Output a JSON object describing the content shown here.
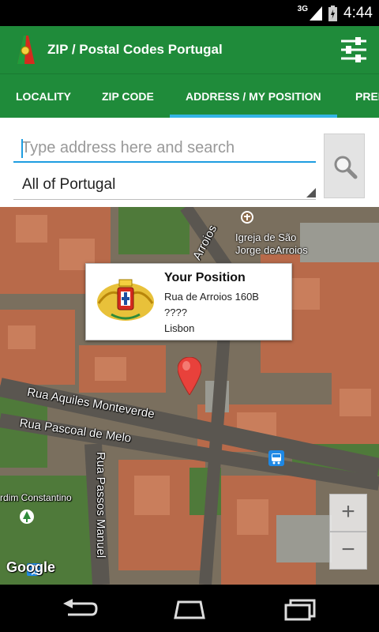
{
  "status_bar": {
    "network": "3G",
    "time": "4:44"
  },
  "app": {
    "title": "ZIP / Postal Codes Portugal",
    "icon": "portugal-flag-icon",
    "menu_icon": "sliders-icon"
  },
  "tabs": [
    {
      "label": "LOCALITY",
      "active": false
    },
    {
      "label": "ZIP CODE",
      "active": false
    },
    {
      "label": "ADDRESS / MY POSITION",
      "active": true
    },
    {
      "label": "PREF",
      "active": false
    }
  ],
  "colors": {
    "primary": "#1f8b3a",
    "tab_indicator": "#33b5e5",
    "marker": "#e8413b",
    "input_underline": "#1e9de0"
  },
  "search": {
    "placeholder": "Type address here and search",
    "value": "",
    "button_icon": "magnifier-icon"
  },
  "region_select": {
    "selected": "All of Portugal"
  },
  "map": {
    "streets": [
      "Rua Aquiles Monteverde",
      "Rua Pascoal de Melo",
      "Rua Passos Manuel",
      "Arroios"
    ],
    "poi": {
      "line1": "Igreja de São",
      "line2": "Jorge deArroios"
    },
    "partial_label": "rdim Constantino",
    "info_window": {
      "title": "Your Position",
      "street": "Rua de Arroios 160B",
      "zip": "????",
      "city": "Lisbon"
    },
    "zoom_in": "+",
    "zoom_out": "−",
    "attribution": "Google"
  },
  "nav": {
    "back_icon": "back-icon",
    "home_icon": "home-icon",
    "recents_icon": "recents-icon"
  }
}
